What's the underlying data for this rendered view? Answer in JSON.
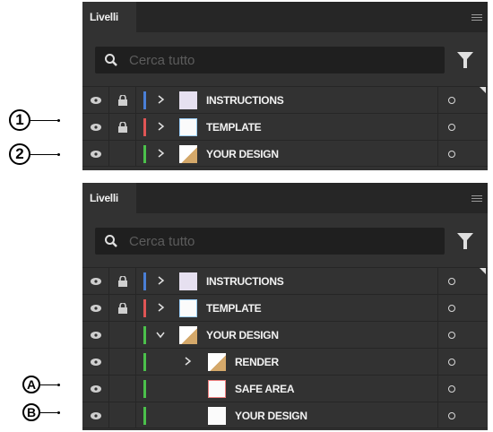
{
  "colors": {
    "panel_bg": "#323232",
    "tabbar_bg": "#262626",
    "search_bg": "#1f1f1f",
    "blue": "#4a7fd6",
    "red": "#e05555",
    "green": "#4bc14b"
  },
  "panel_top": {
    "tab_label": "Livelli",
    "search_placeholder": "Cerca tutto",
    "layers": [
      {
        "name": "INSTRUCTIONS",
        "color": "blue"
      },
      {
        "name": "TEMPLATE",
        "color": "red"
      },
      {
        "name": "YOUR DESIGN",
        "color": "green"
      }
    ]
  },
  "panel_bottom": {
    "tab_label": "Livelli",
    "search_placeholder": "Cerca tutto",
    "layers": [
      {
        "name": "INSTRUCTIONS",
        "color": "blue"
      },
      {
        "name": "TEMPLATE",
        "color": "red"
      },
      {
        "name": "YOUR DESIGN",
        "color": "green",
        "expanded": true
      },
      {
        "name": "RENDER",
        "color": "green"
      },
      {
        "name": "SAFE AREA",
        "color": "green"
      },
      {
        "name": "YOUR DESIGN",
        "color": "green"
      }
    ]
  },
  "callouts": {
    "c1": "1",
    "c2": "2",
    "cA": "A",
    "cB": "B"
  }
}
